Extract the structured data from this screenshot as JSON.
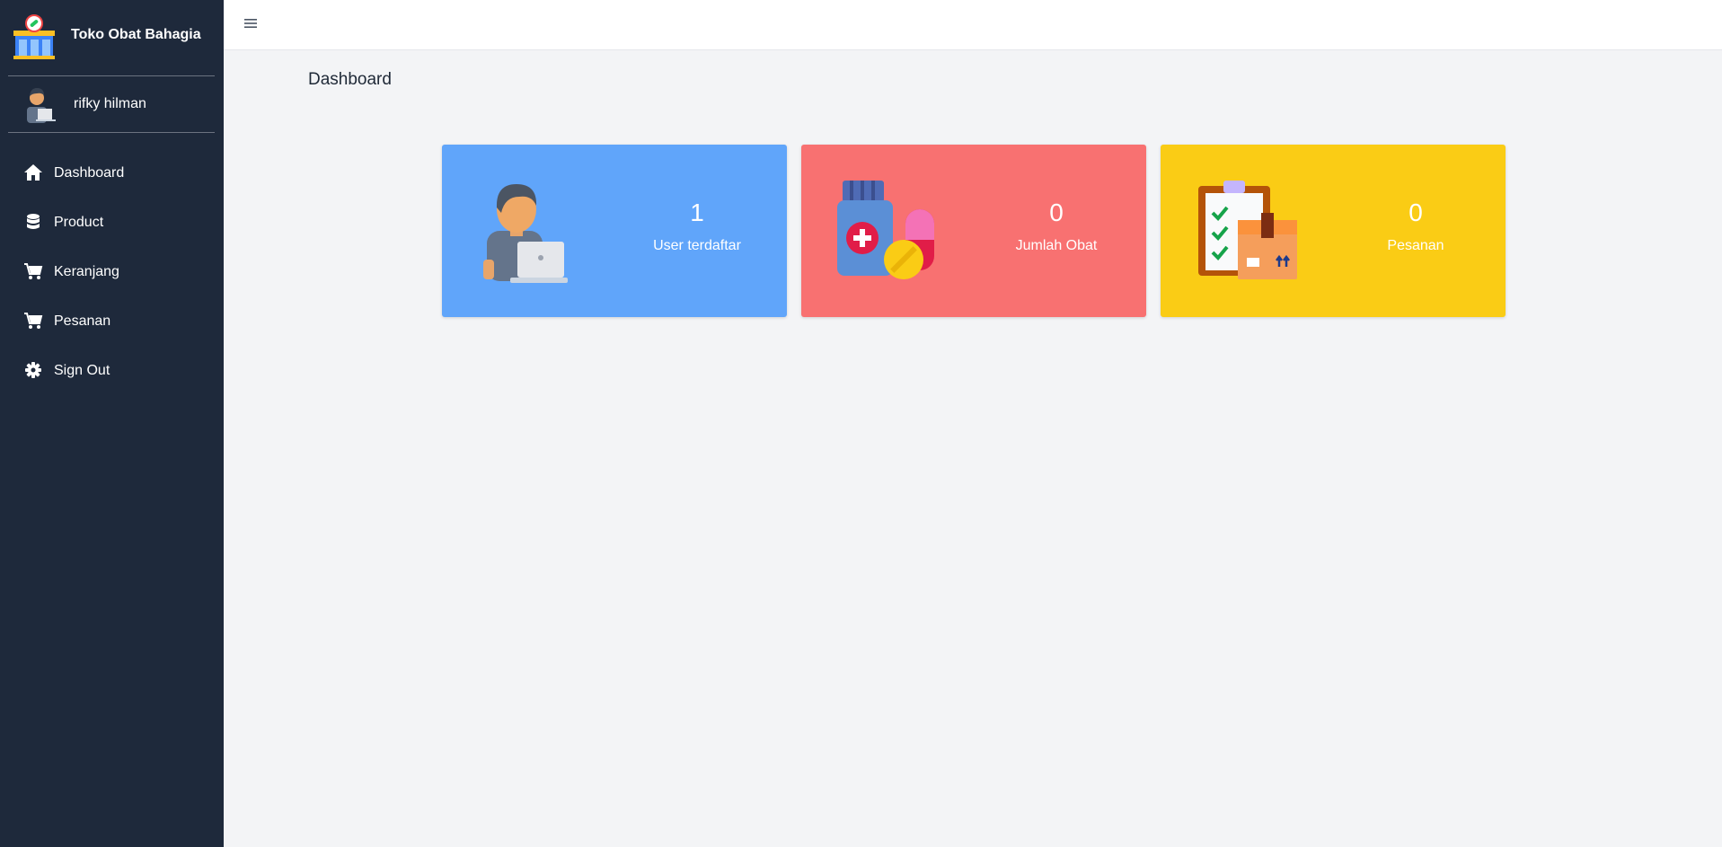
{
  "app": {
    "name": "Toko Obat Bahagia"
  },
  "user": {
    "name": "rifky hilman"
  },
  "sidebar": {
    "items": [
      {
        "label": "Dashboard",
        "icon": "home-icon"
      },
      {
        "label": "Product",
        "icon": "database-icon"
      },
      {
        "label": "Keranjang",
        "icon": "cart-icon"
      },
      {
        "label": "Pesanan",
        "icon": "cart-icon"
      },
      {
        "label": "Sign Out",
        "icon": "gear-icon"
      }
    ]
  },
  "page": {
    "title": "Dashboard"
  },
  "cards": [
    {
      "value": "1",
      "label": "User terdaftar",
      "color": "#60a5fa",
      "icon": "user-laptop-icon"
    },
    {
      "value": "0",
      "label": "Jumlah Obat",
      "color": "#f87171",
      "icon": "medicine-icon"
    },
    {
      "value": "0",
      "label": "Pesanan",
      "color": "#facc15",
      "icon": "order-package-icon"
    }
  ],
  "colors": {
    "sidebar": "#1e293b",
    "background": "#f3f4f6"
  }
}
